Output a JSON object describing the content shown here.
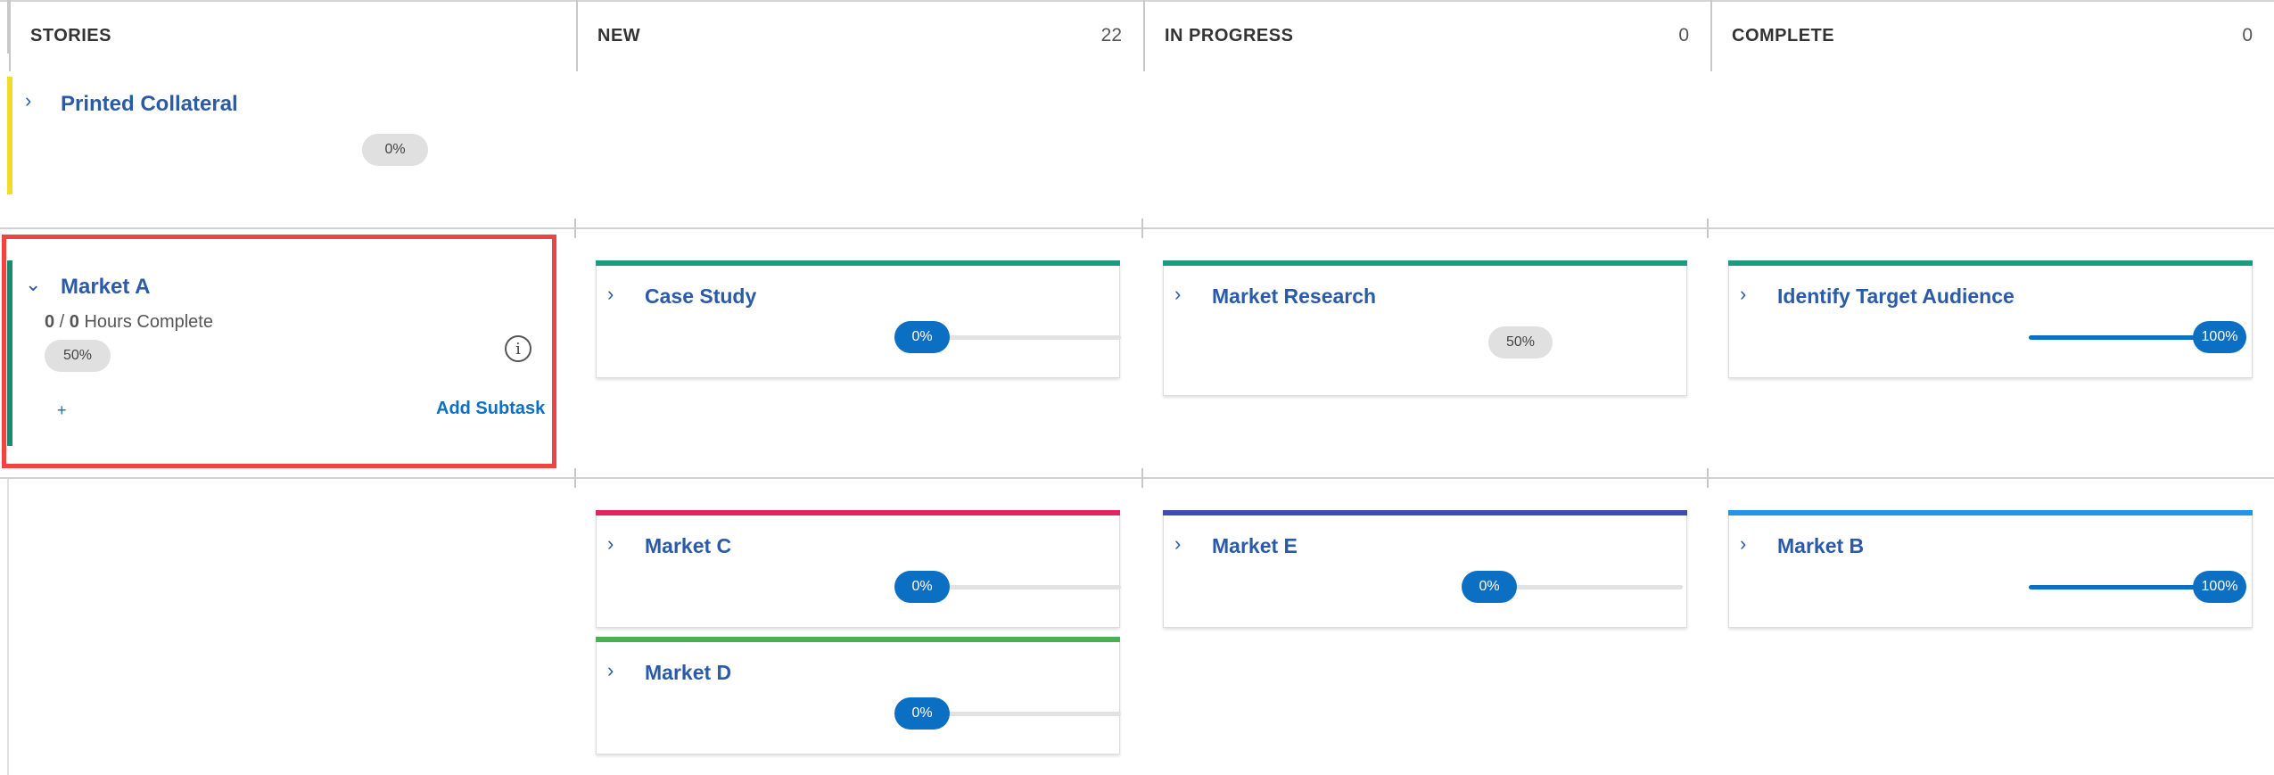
{
  "columns": [
    {
      "title": "STORIES",
      "count": ""
    },
    {
      "title": "NEW",
      "count": "22"
    },
    {
      "title": "IN PROGRESS",
      "count": "0"
    },
    {
      "title": "COMPLETE",
      "count": "0"
    }
  ],
  "stories": [
    {
      "title": "Printed Collateral",
      "percent": "0%",
      "color": "#f0dc2d",
      "expanded": false
    },
    {
      "title": "Market A",
      "percent": "50%",
      "color": "#1a8a72",
      "expanded": true,
      "hours_done": "0",
      "hours_sep": " / ",
      "hours_total": "0",
      "hours_label": " Hours Complete",
      "add_plus": "+",
      "add_label": "Add Subtask",
      "info_symbol": "i"
    }
  ],
  "cards": {
    "case_study": {
      "title": "Case Study",
      "percent": "0%",
      "progress": 0,
      "color": "#1a9a80"
    },
    "market_research": {
      "title": "Market Research",
      "percent": "50%",
      "color": "#1a9a80"
    },
    "identify_target": {
      "title": "Identify Target Audience",
      "percent": "100%",
      "progress": 1,
      "color": "#1a9a80"
    },
    "market_c": {
      "title": "Market C",
      "percent": "0%",
      "progress": 0,
      "color": "#e0245e"
    },
    "market_e": {
      "title": "Market E",
      "percent": "0%",
      "progress": 0,
      "color": "#3f4db0"
    },
    "market_b": {
      "title": "Market B",
      "percent": "100%",
      "progress": 1,
      "color": "#2196e8"
    },
    "market_d": {
      "title": "Market D",
      "percent": "0%",
      "progress": 0,
      "color": "#4caf50"
    }
  },
  "icons": {
    "chevron_right": "›",
    "chevron_down": "⌄"
  }
}
